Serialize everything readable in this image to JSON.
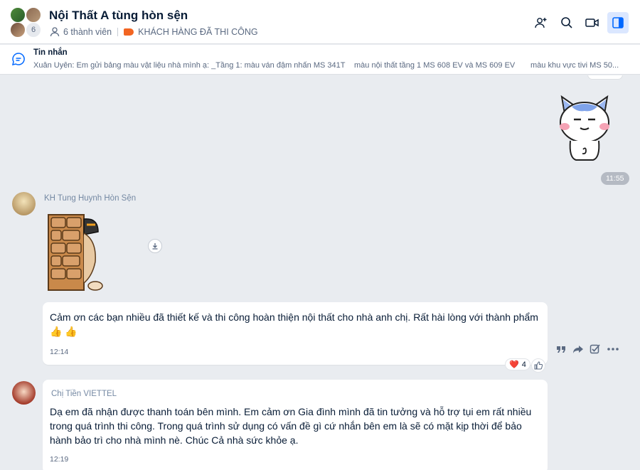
{
  "header": {
    "title": "Nội Thất A tùng hòn sện",
    "avatar_extra_count": "6",
    "members_label": "6 thành viên",
    "tag_label": "KHÁCH HÀNG ĐÃ THI CÔNG",
    "tag_color": "#f26522",
    "toolbar_icons": [
      "add-member-icon",
      "search-icon",
      "video-call-icon",
      "panel-toggle-icon"
    ]
  },
  "pinned": {
    "title": "Tin nhắn",
    "snippet_1": "Xuân Uyên: Em gửi bảng màu vật liệu nhà mình ạ: _Tầng 1: màu ván đậm nhấn MS 341T",
    "snippet_2": "màu nội thất tầng 1 MS 608 EV và MS 609 EV",
    "snippet_3": "màu khu vực tivi MS 50..."
  },
  "messages": [
    {
      "type": "sticker",
      "from_me": true,
      "sticker": "white-cat-sticker",
      "time": "11:55"
    },
    {
      "sender": "KH Tung Huynh Hòn Sện",
      "sticker": "wall-peek-sticker",
      "text": "Cảm ơn các bạn nhiều đã thiết kế và thi công hoàn thiện nội thất cho nhà anh chị. Rất hài lòng với thành phẩm 👍 👍",
      "time": "12:14",
      "reaction_emoji": "❤️",
      "reaction_count": "4"
    },
    {
      "sender": "Chị Tiền VIETTEL",
      "text": "Dạ em đã nhận được thanh toán bên mình. Em cảm ơn Gia đình mình đã tin tưởng và hỗ trợ tụi em rất nhiều trong quá trình thi công. Trong quá trình sử dụng có vấn đề gì cứ nhắn bên em là sẽ có mặt kịp thời để bảo hành bảo trì cho nhà mình nè. Chúc Cả nhà sức khỏe ạ.",
      "time": "12:19"
    }
  ],
  "colors": {
    "accent": "#0068ff",
    "chat_bg": "#e9ecf0"
  }
}
